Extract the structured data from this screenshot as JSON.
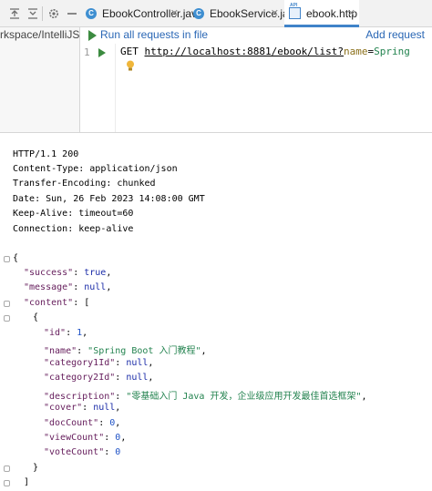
{
  "toolbar": {
    "icons": [
      "collapse-icon",
      "expand-icon",
      "gear-icon",
      "minimize-icon"
    ]
  },
  "tabs": [
    {
      "label": "EbookController.java",
      "icon": "class-icon",
      "active": false
    },
    {
      "label": "EbookService.java",
      "icon": "class-icon",
      "active": false
    },
    {
      "label": "ebook.http",
      "icon": "api-icon",
      "active": true
    }
  ],
  "project_path": "rkspace/IntelliJSpac",
  "editor": {
    "run_all_label": "Run all requests in file",
    "add_request_label": "Add request",
    "line_number": "1",
    "request": {
      "method": "GET",
      "url": "http://localhost:8881/ebook/list?",
      "param": "name",
      "eq": "=",
      "value": "Spring"
    }
  },
  "response": {
    "headers": [
      "HTTP/1.1 200",
      "Content-Type: application/json",
      "Transfer-Encoding: chunked",
      "Date: Sun, 26 Feb 2023 14:08:00 GMT",
      "Keep-Alive: timeout=60",
      "Connection: keep-alive"
    ],
    "body": {
      "open_brace": "{",
      "success_key": "\"success\"",
      "success_val": "true",
      "message_key": "\"message\"",
      "message_val": "null",
      "content_key": "\"content\"",
      "content_open": "[",
      "item_open": "{",
      "fields": [
        {
          "key": "\"id\"",
          "value": "1",
          "type": "num"
        },
        {
          "key": "\"name\"",
          "value": "\"Spring Boot 入门教程\"",
          "type": "str"
        },
        {
          "key": "\"category1Id\"",
          "value": "null",
          "type": "kw"
        },
        {
          "key": "\"category2Id\"",
          "value": "null",
          "type": "kw"
        },
        {
          "key": "\"description\"",
          "value": "\"零基础入门 Java 开发，企业级应用开发最佳首选框架\"",
          "type": "str"
        },
        {
          "key": "\"cover\"",
          "value": "null",
          "type": "kw"
        },
        {
          "key": "\"docCount\"",
          "value": "0",
          "type": "num"
        },
        {
          "key": "\"viewCount\"",
          "value": "0",
          "type": "num"
        },
        {
          "key": "\"voteCount\"",
          "value": "0",
          "type": "num"
        }
      ],
      "item_close": "}",
      "content_close": "]"
    }
  }
}
